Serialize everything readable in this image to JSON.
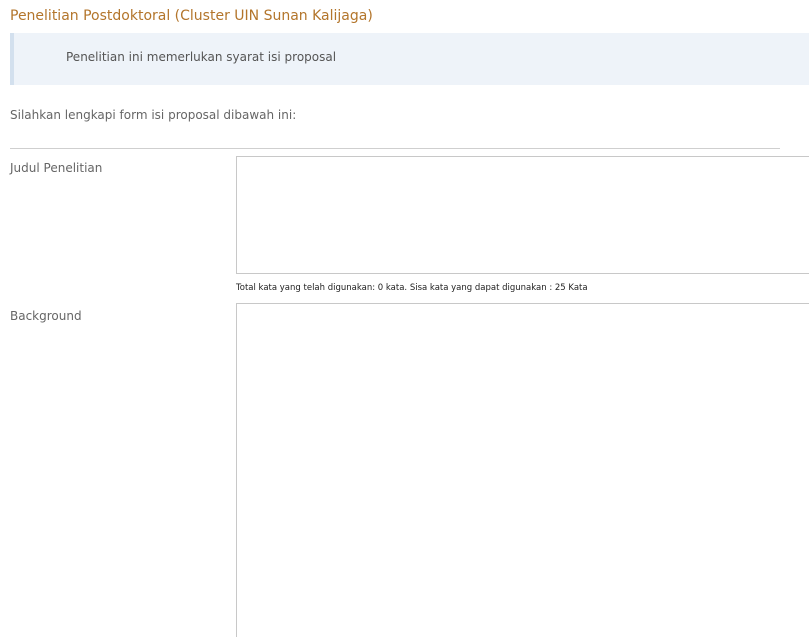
{
  "page": {
    "title": "Penelitian Postdoktoral (Cluster UIN Sunan Kalijaga)"
  },
  "alert": {
    "message": "Penelitian ini memerlukan syarat isi proposal"
  },
  "form": {
    "instruction": "Silahkan lengkapi form isi proposal dibawah ini:",
    "fields": [
      {
        "label": "Judul Penelitian",
        "value": "",
        "word_count_text": "Total kata yang telah digunakan: 0 kata. Sisa kata yang dapat digunakan : 25 Kata"
      },
      {
        "label": "Background",
        "value": ""
      }
    ]
  },
  "colors": {
    "title": "#b3752b",
    "alert_background": "#eef3f9",
    "alert_border": "#d3e0ee"
  }
}
